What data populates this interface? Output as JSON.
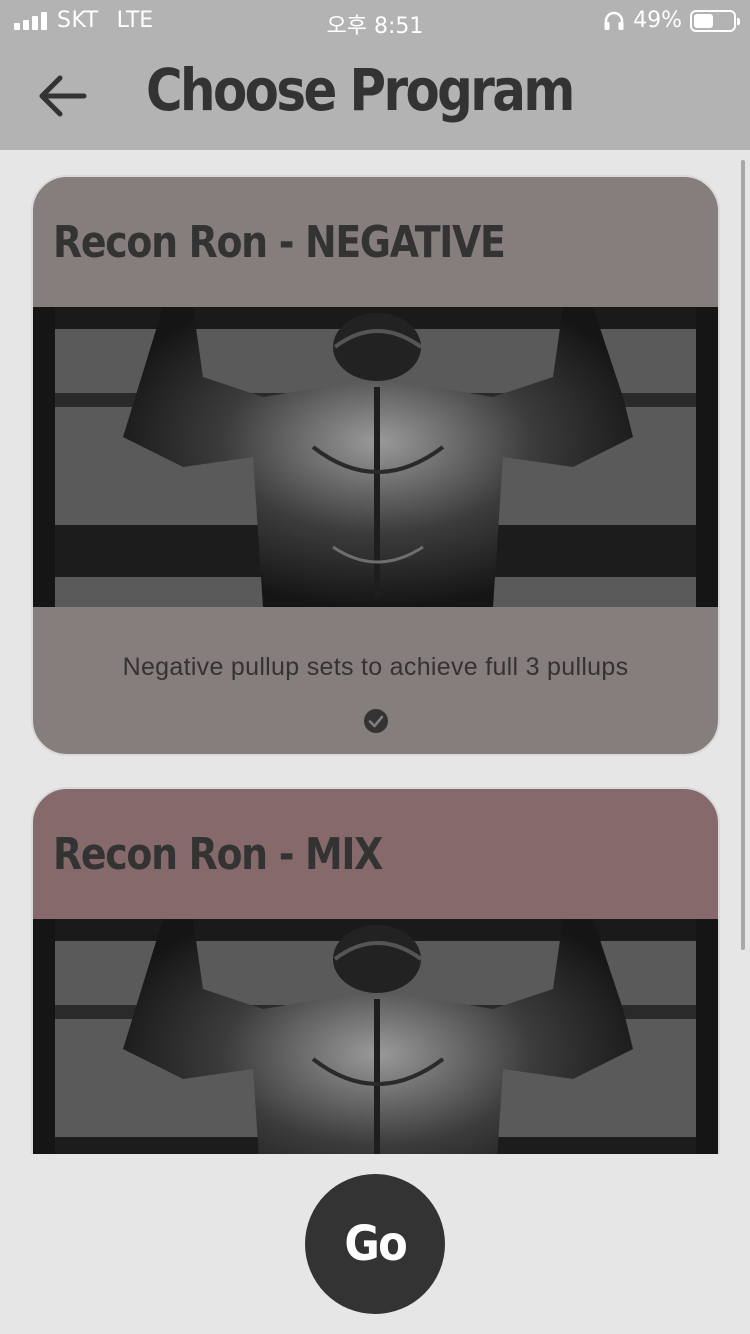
{
  "status_bar": {
    "carrier": "SKT",
    "network": "LTE",
    "time": "오후 8:51",
    "battery": "49%",
    "battery_level": 0.49
  },
  "header": {
    "title": "Choose Program",
    "back_icon": "arrow-left-icon"
  },
  "programs": [
    {
      "title": "Recon Ron - NEGATIVE",
      "description": "Negative pullup sets to achieve full 3 pullups",
      "selected": true,
      "background": "#867d7d"
    },
    {
      "title": "Recon Ron - MIX",
      "description": "",
      "selected": false,
      "background": "#866a6b"
    }
  ],
  "go_button": {
    "label": "Go"
  },
  "colors": {
    "app_bar": "#b3b3b3",
    "page_background": "#e6e6e6",
    "text": "#333333",
    "go_button": "#333333"
  }
}
